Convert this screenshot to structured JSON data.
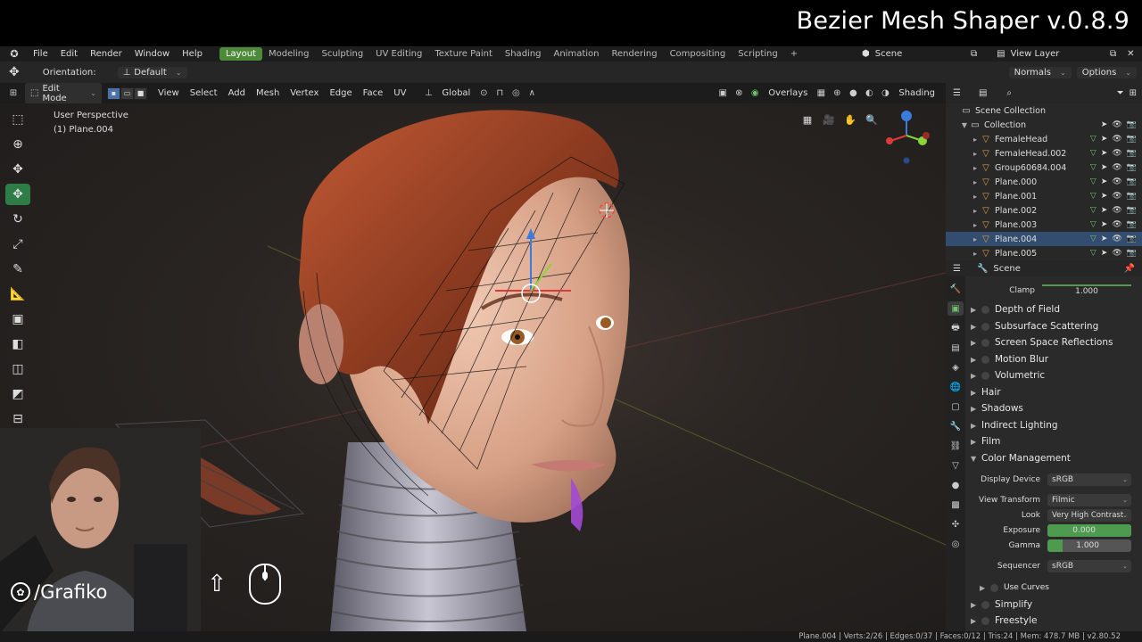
{
  "overlay_title": "Bezier Mesh Shaper v.0.8.9",
  "menu": [
    "File",
    "Edit",
    "Render",
    "Window",
    "Help"
  ],
  "workspaces": [
    {
      "label": "Layout",
      "active": true
    },
    {
      "label": "Modeling"
    },
    {
      "label": "Sculpting"
    },
    {
      "label": "UV Editing"
    },
    {
      "label": "Texture Paint"
    },
    {
      "label": "Shading"
    },
    {
      "label": "Animation"
    },
    {
      "label": "Rendering"
    },
    {
      "label": "Compositing"
    },
    {
      "label": "Scripting"
    }
  ],
  "add_workspace": "+",
  "scene_label": "Scene",
  "view_layer_label": "View Layer",
  "tool_settings": {
    "orientation_label": "Orientation:",
    "orientation_value": "Default",
    "normals": "Normals",
    "options": "Options"
  },
  "viewport_header": {
    "mode": "Edit Mode",
    "menus": [
      "View",
      "Select",
      "Add",
      "Mesh",
      "Vertex",
      "Edge",
      "Face",
      "UV"
    ],
    "transform_orientation": "Global",
    "overlays": "Overlays",
    "shading": "Shading"
  },
  "viewport_info": {
    "line1": "User Perspective",
    "line2": "(1) Plane.004"
  },
  "outliner": {
    "root": "Scene Collection",
    "collection": "Collection",
    "items": [
      {
        "name": "FemaleHead"
      },
      {
        "name": "FemaleHead.002"
      },
      {
        "name": "Group60684.004"
      },
      {
        "name": "Plane.000"
      },
      {
        "name": "Plane.001"
      },
      {
        "name": "Plane.002"
      },
      {
        "name": "Plane.003"
      },
      {
        "name": "Plane.004",
        "selected": true
      },
      {
        "name": "Plane.005"
      }
    ]
  },
  "properties": {
    "header": "Scene",
    "clamp_label": "Clamp",
    "clamp_value": "1.000",
    "sections": [
      {
        "label": "Depth of Field",
        "checkbox": true
      },
      {
        "label": "Subsurface Scattering",
        "checkbox": true
      },
      {
        "label": "Screen Space Reflections",
        "checkbox": true
      },
      {
        "label": "Motion Blur",
        "checkbox": true
      },
      {
        "label": "Volumetric",
        "checkbox": true
      },
      {
        "label": "Hair"
      },
      {
        "label": "Shadows"
      },
      {
        "label": "Indirect Lighting"
      },
      {
        "label": "Film"
      },
      {
        "label": "Color Management",
        "open": true
      }
    ],
    "color_management": {
      "display_device_label": "Display Device",
      "display_device": "sRGB",
      "view_transform_label": "View Transform",
      "view_transform": "Filmic",
      "look_label": "Look",
      "look": "Very High Contrast",
      "exposure_label": "Exposure",
      "exposure": "0.000",
      "gamma_label": "Gamma",
      "gamma": "1.000",
      "sequencer_label": "Sequencer",
      "sequencer": "sRGB",
      "use_curves": "Use Curves"
    },
    "after_sections": [
      {
        "label": "Simplify",
        "checkbox": true
      },
      {
        "label": "Freestyle",
        "checkbox": true
      }
    ]
  },
  "status_bar": "Plane.004 | Verts:2/26 | Edges:0/37 | Faces:0/12 | Tris:24 | Mem: 478.7 MB | v2.80.52",
  "brand": "/Grafiko",
  "colors": {
    "accent_green": "#4d8a3a",
    "selection_blue": "#334d70",
    "hair": "#a4492c",
    "skin": "#e2b49b"
  }
}
